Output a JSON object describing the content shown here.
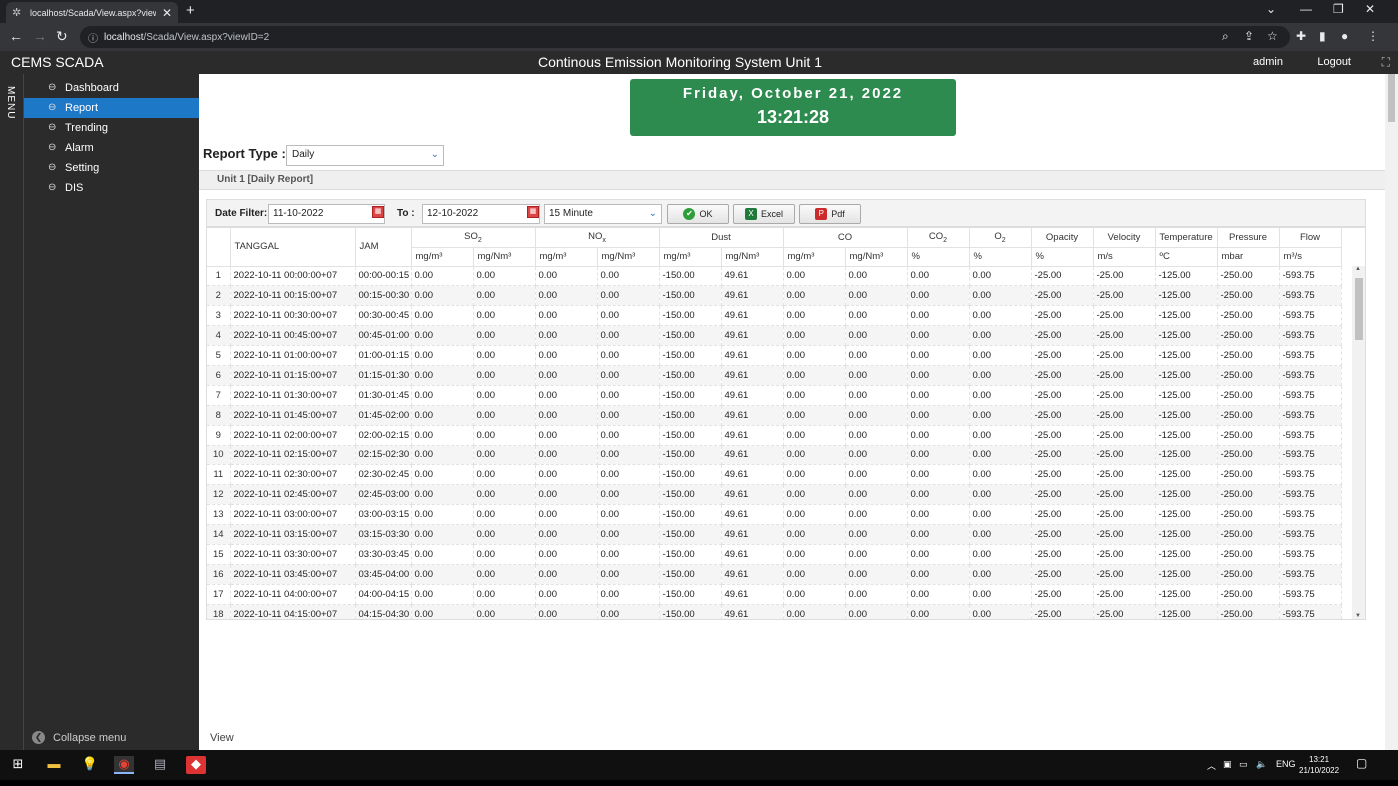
{
  "browser": {
    "tab_title": "localhost/Scada/View.aspx?viewI",
    "url_host": "localhost",
    "url_path": "/Scada/View.aspx?viewID=2"
  },
  "app": {
    "brand": "CEMS SCADA",
    "title": "Continous Emission Monitoring System Unit 1",
    "user": "admin",
    "logout": "Logout"
  },
  "sidebar": {
    "menu_label": "MENU",
    "items": [
      {
        "label": "Dashboard"
      },
      {
        "label": "Report"
      },
      {
        "label": "Trending"
      },
      {
        "label": "Alarm"
      },
      {
        "label": "Setting"
      },
      {
        "label": "DIS"
      }
    ],
    "collapse": "Collapse menu"
  },
  "clock": {
    "date": "Friday, October 21, 2022",
    "time": "13:21:28"
  },
  "report": {
    "type_label": "Report Type :",
    "type_value": "Daily",
    "panel_title": "Unit 1 [Daily Report]",
    "date_filter_label": "Date Filter:",
    "date_from": "11-10-2022",
    "to_label": "To :",
    "date_to": "12-10-2022",
    "interval": "15 Minute",
    "ok": "OK",
    "excel": "Excel",
    "pdf": "Pdf"
  },
  "table": {
    "group_headers": [
      "TANGGAL",
      "JAM",
      "SO2",
      "NOx",
      "Dust",
      "CO",
      "CO2",
      "O2",
      "Opacity",
      "Velocity",
      "Temperature",
      "Pressure",
      "Flow"
    ],
    "units": [
      "mg/m³",
      "mg/Nm³",
      "mg/m³",
      "mg/Nm³",
      "mg/m³",
      "mg/Nm³",
      "mg/m³",
      "mg/Nm³",
      "%",
      "%",
      "%",
      "m/s",
      "ºC",
      "mbar",
      "m³/s"
    ],
    "values": [
      "0.00",
      "0.00",
      "0.00",
      "0.00",
      "-150.00",
      "49.61",
      "0.00",
      "0.00",
      "0.00",
      "0.00",
      "-25.00",
      "-25.00",
      "-125.00",
      "-250.00",
      "-593.75"
    ],
    "rows": [
      {
        "n": "1",
        "tanggal": "2022-10-11 00:00:00+07",
        "jam": "00:00-00:15"
      },
      {
        "n": "2",
        "tanggal": "2022-10-11 00:15:00+07",
        "jam": "00:15-00:30"
      },
      {
        "n": "3",
        "tanggal": "2022-10-11 00:30:00+07",
        "jam": "00:30-00:45"
      },
      {
        "n": "4",
        "tanggal": "2022-10-11 00:45:00+07",
        "jam": "00:45-01:00"
      },
      {
        "n": "5",
        "tanggal": "2022-10-11 01:00:00+07",
        "jam": "01:00-01:15"
      },
      {
        "n": "6",
        "tanggal": "2022-10-11 01:15:00+07",
        "jam": "01:15-01:30"
      },
      {
        "n": "7",
        "tanggal": "2022-10-11 01:30:00+07",
        "jam": "01:30-01:45"
      },
      {
        "n": "8",
        "tanggal": "2022-10-11 01:45:00+07",
        "jam": "01:45-02:00"
      },
      {
        "n": "9",
        "tanggal": "2022-10-11 02:00:00+07",
        "jam": "02:00-02:15"
      },
      {
        "n": "10",
        "tanggal": "2022-10-11 02:15:00+07",
        "jam": "02:15-02:30"
      },
      {
        "n": "11",
        "tanggal": "2022-10-11 02:30:00+07",
        "jam": "02:30-02:45"
      },
      {
        "n": "12",
        "tanggal": "2022-10-11 02:45:00+07",
        "jam": "02:45-03:00"
      },
      {
        "n": "13",
        "tanggal": "2022-10-11 03:00:00+07",
        "jam": "03:00-03:15"
      },
      {
        "n": "14",
        "tanggal": "2022-10-11 03:15:00+07",
        "jam": "03:15-03:30"
      },
      {
        "n": "15",
        "tanggal": "2022-10-11 03:30:00+07",
        "jam": "03:30-03:45"
      },
      {
        "n": "16",
        "tanggal": "2022-10-11 03:45:00+07",
        "jam": "03:45-04:00"
      },
      {
        "n": "17",
        "tanggal": "2022-10-11 04:00:00+07",
        "jam": "04:00-04:15"
      },
      {
        "n": "18",
        "tanggal": "2022-10-11 04:15:00+07",
        "jam": "04:15-04:30"
      }
    ]
  },
  "footer": "View",
  "taskbar": {
    "lang": "ENG",
    "time": "13:21",
    "date": "21/10/2022"
  },
  "colors": {
    "clock_bg": "#2e8b4f",
    "active_nav": "#1e78c8",
    "sidebar_bg": "#2b2b2b"
  }
}
